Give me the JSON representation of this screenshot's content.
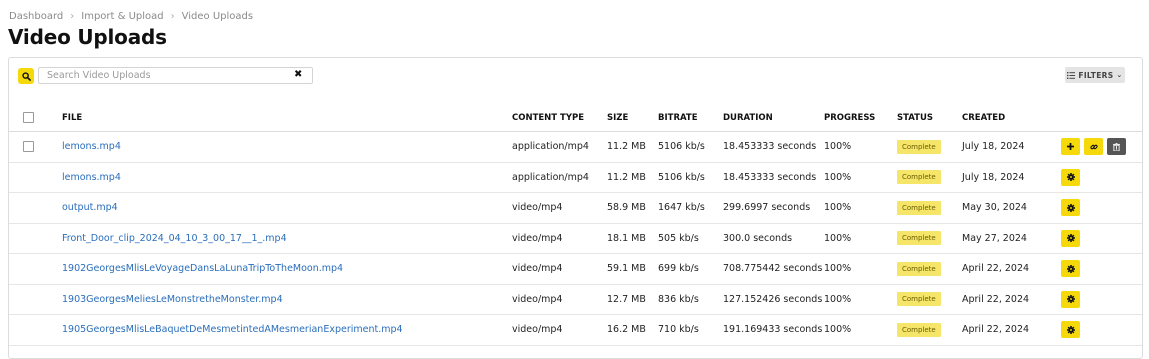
{
  "breadcrumb": [
    "Dashboard",
    "Import & Upload",
    "Video Uploads"
  ],
  "page_title": "Video Uploads",
  "search": {
    "placeholder": "Search Video Uploads",
    "value": ""
  },
  "filters_label": "FILTERS",
  "columns": [
    "FILE",
    "CONTENT TYPE",
    "SIZE",
    "BITRATE",
    "DURATION",
    "PROGRESS",
    "STATUS",
    "CREATED"
  ],
  "rows": [
    {
      "file": "lemons.mp4",
      "content_type": "application/mp4",
      "size": "11.2 MB",
      "bitrate": "5106 kb/s",
      "duration": "18.453333 seconds",
      "progress": "100%",
      "status": "Complete",
      "created": "July 18, 2024"
    },
    {
      "file": "lemons.mp4",
      "content_type": "application/mp4",
      "size": "11.2 MB",
      "bitrate": "5106 kb/s",
      "duration": "18.453333 seconds",
      "progress": "100%",
      "status": "Complete",
      "created": "July 18, 2024"
    },
    {
      "file": "output.mp4",
      "content_type": "video/mp4",
      "size": "58.9 MB",
      "bitrate": "1647 kb/s",
      "duration": "299.6997 seconds",
      "progress": "100%",
      "status": "Complete",
      "created": "May 30, 2024"
    },
    {
      "file": "Front_Door_clip_2024_04_10_3_00_17__1_.mp4",
      "content_type": "video/mp4",
      "size": "18.1 MB",
      "bitrate": "505 kb/s",
      "duration": "300.0 seconds",
      "progress": "100%",
      "status": "Complete",
      "created": "May 27, 2024"
    },
    {
      "file": "1902GeorgesMlisLeVoyageDansLaLunaTripToTheMoon.mp4",
      "content_type": "video/mp4",
      "size": "59.1 MB",
      "bitrate": "699 kb/s",
      "duration": "708.775442 seconds",
      "progress": "100%",
      "status": "Complete",
      "created": "April 22, 2024"
    },
    {
      "file": "1903GeorgesMeliesLeMonstretheMonster.mp4",
      "content_type": "video/mp4",
      "size": "12.7 MB",
      "bitrate": "836 kb/s",
      "duration": "127.152426 seconds",
      "progress": "100%",
      "status": "Complete",
      "created": "April 22, 2024"
    },
    {
      "file": "1905GeorgesMlisLeBaquetDeMesmetintedAMesmerianExperiment.mp4",
      "content_type": "video/mp4",
      "size": "16.2 MB",
      "bitrate": "710 kb/s",
      "duration": "191.169433 seconds",
      "progress": "100%",
      "status": "Complete",
      "created": "April 22, 2024"
    }
  ],
  "icons": {
    "search": "search-icon",
    "clear": "close-icon",
    "filters": "list-icon",
    "add": "plus-icon",
    "link": "link-icon",
    "delete": "trash-icon",
    "settings": "gear-icon"
  },
  "colors": {
    "accent": "#f5d90a",
    "badge": "#f5e66a",
    "link": "#2a6ebb",
    "dark_button": "#555555"
  }
}
